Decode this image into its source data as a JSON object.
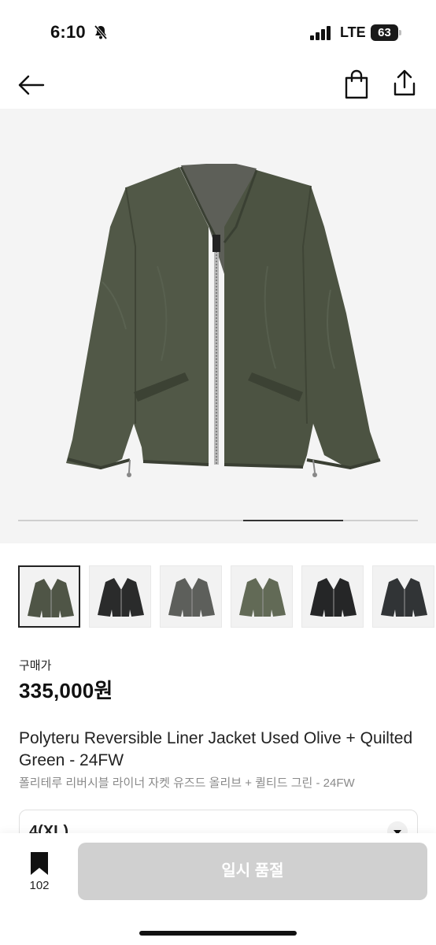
{
  "status_bar": {
    "time": "6:10",
    "network": "LTE",
    "battery": "63",
    "icons": [
      "bell-slash-icon",
      "signal-icon",
      "battery-icon"
    ]
  },
  "nav": {
    "icons": [
      "back-arrow-icon",
      "shopping-bag-icon",
      "share-icon"
    ]
  },
  "gallery": {
    "progress": 0.75,
    "thumbnail_count": 6,
    "selected_index": 0,
    "thumb_colors": [
      "#4f5546",
      "#2a2b2b",
      "#5d5f5b",
      "#626a56",
      "#252627",
      "#313436"
    ]
  },
  "price": {
    "label": "구매가",
    "value": "335,000원"
  },
  "product": {
    "title": "Polyteru Reversible Liner Jacket Used Olive + Quilted Green - 24FW",
    "subtitle": "폴리테루 리버시블 라이너 자켓 유즈드 올리브 + 퀼티드 그린 - 24FW"
  },
  "option": {
    "selected": "4(XL)",
    "icon": "chevron-down-icon"
  },
  "bottom_bar": {
    "bookmark_count": "102",
    "soldout_label": "일시 품절",
    "icon": "bookmark-icon"
  },
  "colors": {
    "jacket_olive": "#4e5545",
    "button_disabled": "#d0d0d0",
    "image_background": "#f4f4f4"
  }
}
